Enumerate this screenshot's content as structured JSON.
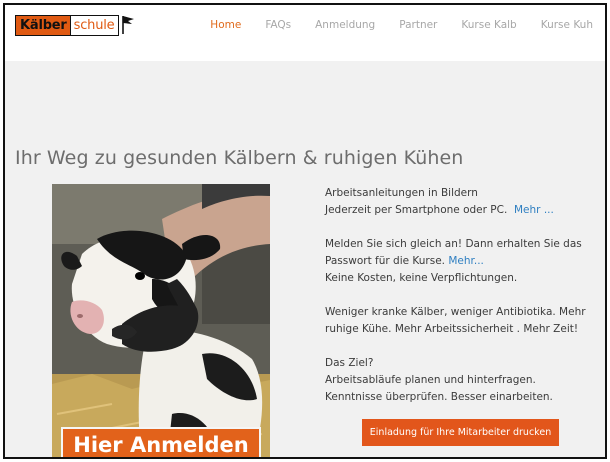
{
  "logo": {
    "part1": "Kälber",
    "part2": "schule"
  },
  "nav": {
    "items": [
      {
        "label": "Home",
        "active": true
      },
      {
        "label": "FAQs",
        "active": false
      },
      {
        "label": "Anmeldung",
        "active": false
      },
      {
        "label": "Partner",
        "active": false
      },
      {
        "label": "Kurse Kalb",
        "active": false
      },
      {
        "label": "Kurse Kuh",
        "active": false
      }
    ]
  },
  "hero": {
    "headline": "Ihr Weg zu gesunden Kälbern & ruhigen Kühen",
    "cta_banner": "Hier Anmelden"
  },
  "content": {
    "p1_line1": "Arbeitsanleitungen in Bildern",
    "p1_line2": "Jederzeit per Smartphone oder PC.",
    "p1_link": "Mehr ...",
    "p2_line1": "Melden Sie sich gleich an! Dann erhalten Sie das",
    "p2_line2": "Passwort für die Kurse.",
    "p2_link": "Mehr...",
    "p2_line3": "Keine Kosten, keine Verpflichtungen.",
    "p3_line1": "Weniger kranke Kälber, weniger Antibiotika. Mehr",
    "p3_line2": "ruhige Kühe. Mehr Arbeitssicherheit . Mehr Zeit!",
    "p4_line1": "Das Ziel?",
    "p4_line2": "Arbeitsabläufe planen und hinterfragen.",
    "p4_line3": "Kenntnisse überprüfen. Besser einarbeiten."
  },
  "print_button": "Einladung für Ihre Mitarbeiter drucken",
  "colors": {
    "brand_orange": "#e2621b",
    "link_blue": "#2f7fc1",
    "page_background": "#f1f1f1"
  }
}
